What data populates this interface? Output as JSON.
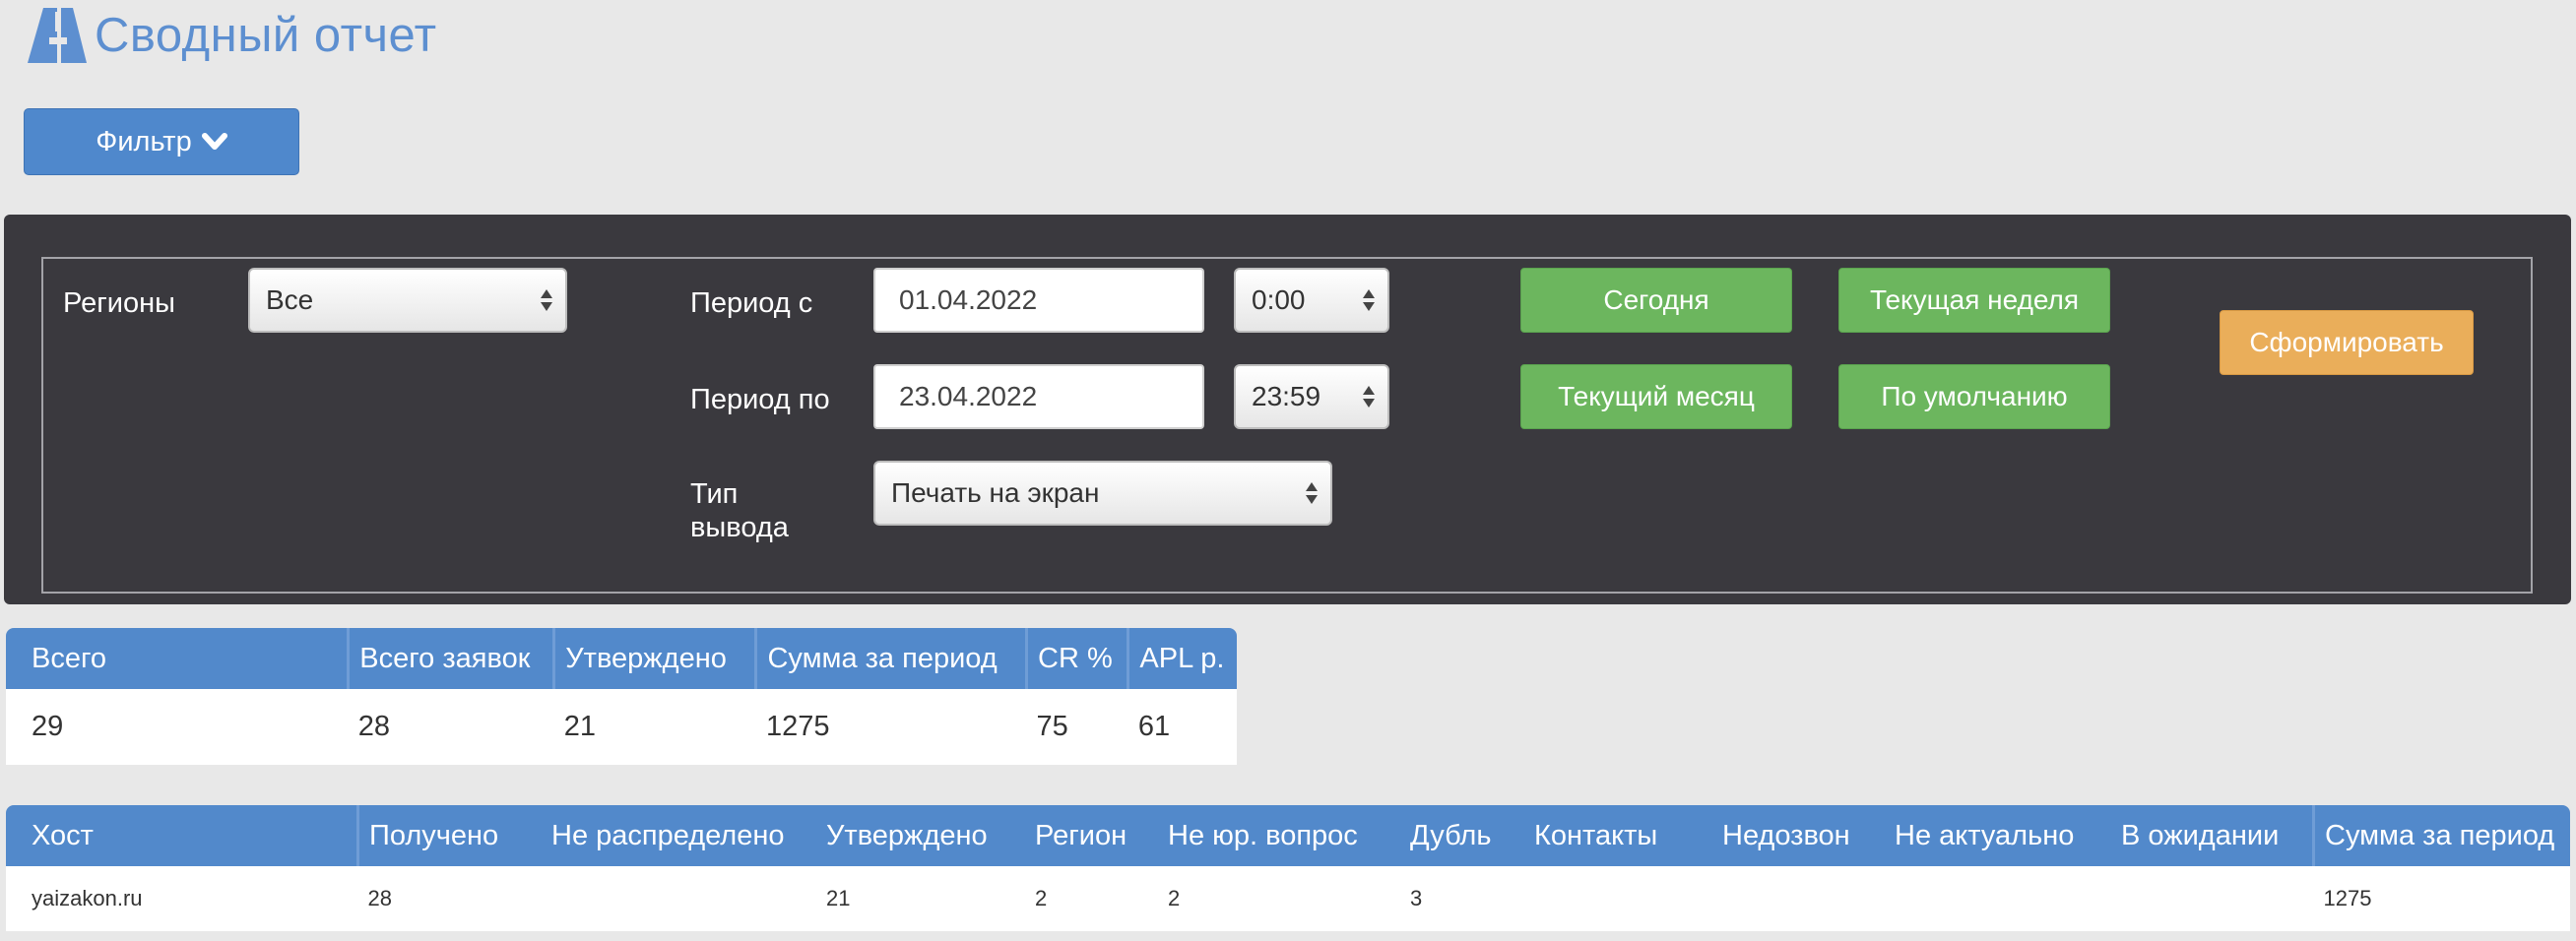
{
  "page": {
    "title": "Сводный отчет"
  },
  "filter_toggle": {
    "label": "Фильтр"
  },
  "filter": {
    "regions_label": "Регионы",
    "regions_value": "Все",
    "period_from_label": "Период с",
    "period_from_date": "01.04.2022",
    "period_from_time": "0:00",
    "period_to_label": "Период по",
    "period_to_date": "23.04.2022",
    "period_to_time": "23:59",
    "output_label_line1": "Тип",
    "output_label_line2": "вывода",
    "output_value": "Печать на экран",
    "today_label": "Сегодня",
    "current_week_label": "Текущая неделя",
    "current_month_label": "Текущий месяц",
    "default_label": "По умолчанию",
    "generate_label": "Сформировать"
  },
  "summary": {
    "headers": [
      "Всего",
      "Всего заявок",
      "Утверждено",
      "Сумма за период",
      "CR %",
      "APL р."
    ],
    "row": [
      "29",
      "28",
      "21",
      "1275",
      "75",
      "61"
    ]
  },
  "hosts": {
    "headers": [
      "Хост",
      "Получено",
      "Не распределено",
      "Утверждено",
      "Регион",
      "Не юр. вопрос",
      "Дубль",
      "Контакты",
      "Недозвон",
      "Не актуально",
      "В ожидании",
      "Сумма за период"
    ],
    "rows": [
      [
        "yaizakon.ru",
        "28",
        "",
        "21",
        "2",
        "2",
        "3",
        "",
        "",
        "",
        "",
        "1275"
      ]
    ]
  },
  "colors": {
    "accent_blue": "#5289cb",
    "green_button": "#6cb65e",
    "orange_button": "#eaae5a",
    "panel_dark": "#3a393e"
  }
}
